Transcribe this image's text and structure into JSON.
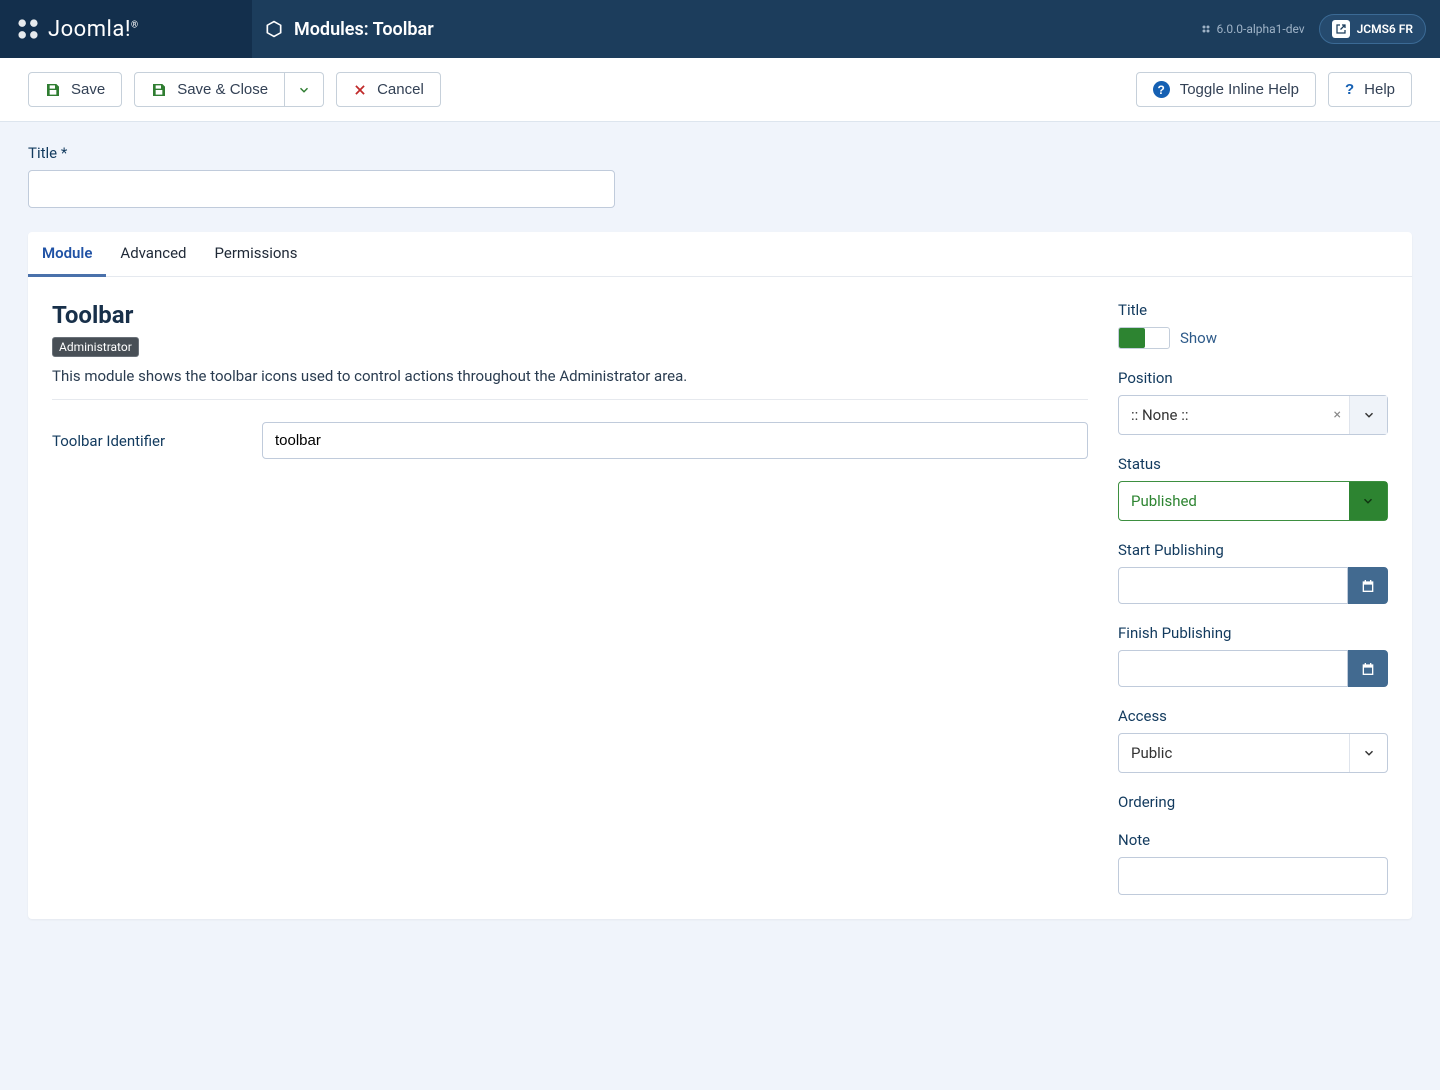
{
  "header": {
    "brand": "Joomla!",
    "page_title": "Modules: Toolbar",
    "version": "6.0.0-alpha1-dev",
    "user_label": "JCMS6 FR"
  },
  "toolbar": {
    "save": "Save",
    "save_close": "Save & Close",
    "cancel": "Cancel",
    "toggle_help": "Toggle Inline Help",
    "help": "Help"
  },
  "form": {
    "title_label": "Title",
    "title_value": ""
  },
  "tabs": {
    "module": "Module",
    "advanced": "Advanced",
    "permissions": "Permissions"
  },
  "module": {
    "heading": "Toolbar",
    "badge": "Administrator",
    "description": "This module shows the toolbar icons used to control actions throughout the Administrator area.",
    "identifier_label": "Toolbar Identifier",
    "identifier_value": "toolbar"
  },
  "side": {
    "title_label": "Title",
    "title_toggle_text": "Show",
    "position_label": "Position",
    "position_value": ":: None ::",
    "status_label": "Status",
    "status_value": "Published",
    "start_label": "Start Publishing",
    "start_value": "",
    "finish_label": "Finish Publishing",
    "finish_value": "",
    "access_label": "Access",
    "access_value": "Public",
    "ordering_label": "Ordering",
    "note_label": "Note",
    "note_value": ""
  }
}
